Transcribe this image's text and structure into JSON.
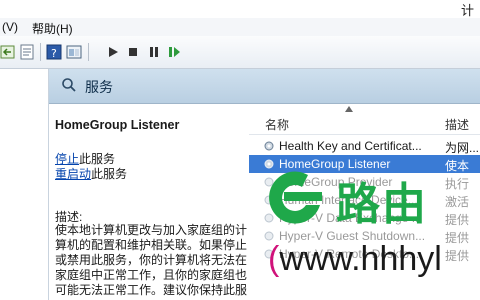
{
  "title_fragment": "计",
  "menu": {
    "view": "(V)",
    "help": "帮助(H)"
  },
  "toolbar_icons": [
    "back-icon",
    "forward-icon",
    "properties-icon",
    "refresh-icon",
    "help-icon",
    "console-icon",
    "play-icon",
    "stop-icon",
    "pause-icon",
    "restart-icon"
  ],
  "header": {
    "title": "服务"
  },
  "detail": {
    "service_name": "HomeGroup Listener",
    "stop_link": "停止",
    "stop_suffix": "此服务",
    "restart_link": "重启动",
    "restart_suffix": "此服务",
    "desc_label": "描述:",
    "desc_lines": [
      "使本地计算机更改与加入家庭组的计",
      "算机的配置和维护相关联。如果停止",
      "或禁用此服务，你的计算机将无法在",
      "家庭组中正常工作，且你的家庭组也",
      "可能无法正常工作。建议你保持此服"
    ]
  },
  "list": {
    "col_name": "名称",
    "col_desc": "描述",
    "rows": [
      {
        "name": "Health Key and Certificat...",
        "desc": "为网..."
      },
      {
        "name": "HomeGroup Listener",
        "desc": "使本"
      },
      {
        "name": "HomeGroup Provider",
        "desc": "执行"
      },
      {
        "name": "Human Interface Device...",
        "desc": "激活"
      },
      {
        "name": "Hyper-V Data Exchange ...",
        "desc": "提供"
      },
      {
        "name": "Hyper-V Guest Shutdown...",
        "desc": "提供"
      },
      {
        "name": "Hyper-V Remote Deskto...",
        "desc": "提供"
      }
    ]
  },
  "watermark": {
    "brand": "路由",
    "url_prefix": "(",
    "url": "www.hhhyl"
  }
}
